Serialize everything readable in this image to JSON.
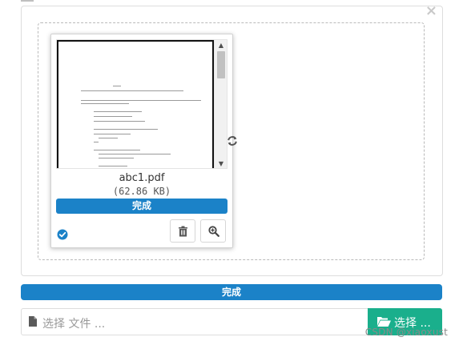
{
  "file_preview": {
    "file_name": "abc1.pdf",
    "file_size": "(62.86 KB)",
    "done_label": "完成",
    "status_icon": "check-circle-icon",
    "delete_icon": "trash-icon",
    "zoom_icon": "zoom-in-icon",
    "rotate_icon": "refresh-icon"
  },
  "upload": {
    "done_label": "完成",
    "caption_placeholder": "选择 文件 ...",
    "browse_label": "选择 ...",
    "file_icon": "file-icon",
    "folder_icon": "folder-open-icon"
  },
  "watermark": "CSDN @xiaoxust",
  "colors": {
    "primary": "#1b82c8",
    "success": "#1aaf8c",
    "border": "#dddddd"
  }
}
